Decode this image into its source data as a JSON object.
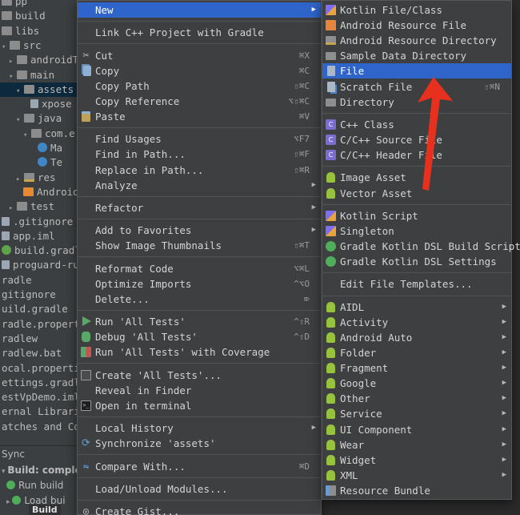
{
  "project_tree": {
    "rows": [
      {
        "label": "pp",
        "indent": 0,
        "arrow": "",
        "icon": "folder"
      },
      {
        "label": "build",
        "indent": 0,
        "arrow": "",
        "icon": "folder"
      },
      {
        "label": "libs",
        "indent": 0,
        "arrow": "",
        "icon": "folder"
      },
      {
        "label": "src",
        "indent": 0,
        "arrow": "▾",
        "icon": "folder"
      },
      {
        "label": "androidTes",
        "indent": 1,
        "arrow": "▸",
        "icon": "folder"
      },
      {
        "label": "main",
        "indent": 1,
        "arrow": "▾",
        "icon": "folder"
      },
      {
        "label": "assets",
        "indent": 2,
        "arrow": "▾",
        "icon": "folder",
        "selected": true
      },
      {
        "label": "xpose",
        "indent": 4,
        "arrow": "",
        "icon": "file"
      },
      {
        "label": "java",
        "indent": 2,
        "arrow": "▾",
        "icon": "folder"
      },
      {
        "label": "com.e",
        "indent": 3,
        "arrow": "▾",
        "icon": "folder"
      },
      {
        "label": "Ma",
        "indent": 5,
        "arrow": "",
        "icon": "cls"
      },
      {
        "label": "Te",
        "indent": 5,
        "arrow": "",
        "icon": "cls"
      },
      {
        "label": "res",
        "indent": 2,
        "arrow": "▸",
        "icon": "res"
      },
      {
        "label": "Android",
        "indent": 3,
        "arrow": "",
        "icon": "android"
      },
      {
        "label": "test",
        "indent": 1,
        "arrow": "▸",
        "icon": "folder"
      },
      {
        "label": ".gitignore",
        "indent": 0,
        "arrow": "",
        "icon": "file"
      },
      {
        "label": "app.iml",
        "indent": 0,
        "arrow": "",
        "icon": "file"
      },
      {
        "label": "build.gradle",
        "indent": 0,
        "arrow": "",
        "icon": "gradle"
      },
      {
        "label": "proguard-rule",
        "indent": 0,
        "arrow": "",
        "icon": "file"
      },
      {
        "label": "radle",
        "indent": 0,
        "arrow": "",
        "icon": ""
      },
      {
        "label": "gitignore",
        "indent": 0,
        "arrow": "",
        "icon": ""
      },
      {
        "label": "uild.gradle",
        "indent": 0,
        "arrow": "",
        "icon": ""
      },
      {
        "label": "radle.properti",
        "indent": 0,
        "arrow": "",
        "icon": ""
      },
      {
        "label": "radlew",
        "indent": 0,
        "arrow": "",
        "icon": ""
      },
      {
        "label": "radlew.bat",
        "indent": 0,
        "arrow": "",
        "icon": ""
      },
      {
        "label": "ocal.propertie",
        "indent": 0,
        "arrow": "",
        "icon": ""
      },
      {
        "label": "ettings.gradle",
        "indent": 0,
        "arrow": "",
        "icon": ""
      },
      {
        "label": "estVpDemo.iml",
        "indent": 0,
        "arrow": "",
        "icon": ""
      },
      {
        "label": "ernal Libraries",
        "indent": 0,
        "arrow": "",
        "icon": ""
      },
      {
        "label": "atches and Cons",
        "indent": 0,
        "arrow": "",
        "icon": ""
      }
    ]
  },
  "build_panel": {
    "sync_label": "Sync",
    "build_status": "Build: comple",
    "run_build": "Run build",
    "load_build": "Load bui",
    "build_tab": "Build"
  },
  "main_menu": {
    "items": [
      {
        "label": "New",
        "shortcut": "",
        "submenu": true,
        "icon": "",
        "active": true
      },
      {
        "sep": true
      },
      {
        "label": "Link C++ Project with Gradle",
        "shortcut": "",
        "submenu": false,
        "icon": ""
      },
      {
        "sep": true
      },
      {
        "label": "Cut",
        "shortcut": "⌘X",
        "submenu": false,
        "icon": "cut"
      },
      {
        "label": "Copy",
        "shortcut": "⌘C",
        "submenu": false,
        "icon": "copy"
      },
      {
        "label": "Copy Path",
        "shortcut": "⇧⌘C",
        "submenu": false,
        "icon": ""
      },
      {
        "label": "Copy Reference",
        "shortcut": "⌥⇧⌘C",
        "submenu": false,
        "icon": ""
      },
      {
        "label": "Paste",
        "shortcut": "⌘V",
        "submenu": false,
        "icon": "paste"
      },
      {
        "sep": true
      },
      {
        "label": "Find Usages",
        "shortcut": "⌥F7",
        "submenu": false,
        "icon": ""
      },
      {
        "label": "Find in Path...",
        "shortcut": "⇧⌘F",
        "submenu": false,
        "icon": ""
      },
      {
        "label": "Replace in Path...",
        "shortcut": "⇧⌘R",
        "submenu": false,
        "icon": ""
      },
      {
        "label": "Analyze",
        "shortcut": "",
        "submenu": true,
        "icon": ""
      },
      {
        "sep": true
      },
      {
        "label": "Refactor",
        "shortcut": "",
        "submenu": true,
        "icon": ""
      },
      {
        "sep": true
      },
      {
        "label": "Add to Favorites",
        "shortcut": "",
        "submenu": true,
        "icon": ""
      },
      {
        "label": "Show Image Thumbnails",
        "shortcut": "⇧⌘T",
        "submenu": false,
        "icon": ""
      },
      {
        "sep": true
      },
      {
        "label": "Reformat Code",
        "shortcut": "⌥⌘L",
        "submenu": false,
        "icon": ""
      },
      {
        "label": "Optimize Imports",
        "shortcut": "^⌥O",
        "submenu": false,
        "icon": ""
      },
      {
        "label": "Delete...",
        "shortcut": "⌦",
        "submenu": false,
        "icon": ""
      },
      {
        "sep": true
      },
      {
        "label": "Run 'All Tests'",
        "shortcut": "^⇧R",
        "submenu": false,
        "icon": "run"
      },
      {
        "label": "Debug 'All Tests'",
        "shortcut": "^⇧D",
        "submenu": false,
        "icon": "debug"
      },
      {
        "label": "Run 'All Tests' with Coverage",
        "shortcut": "",
        "submenu": false,
        "icon": "coverage"
      },
      {
        "sep": true
      },
      {
        "label": "Create 'All Tests'...",
        "shortcut": "",
        "submenu": false,
        "icon": "create"
      },
      {
        "label": "Reveal in Finder",
        "shortcut": "",
        "submenu": false,
        "icon": ""
      },
      {
        "label": "Open in terminal",
        "shortcut": "",
        "submenu": false,
        "icon": "terminal"
      },
      {
        "sep": true
      },
      {
        "label": "Local History",
        "shortcut": "",
        "submenu": true,
        "icon": ""
      },
      {
        "label": "Synchronize 'assets'",
        "shortcut": "",
        "submenu": false,
        "icon": "sync"
      },
      {
        "sep": true
      },
      {
        "label": "Compare With...",
        "shortcut": "⌘D",
        "submenu": false,
        "icon": "compare"
      },
      {
        "sep": true
      },
      {
        "label": "Load/Unload Modules...",
        "shortcut": "",
        "submenu": false,
        "icon": ""
      },
      {
        "sep": true
      },
      {
        "label": "Create Gist...",
        "shortcut": "",
        "submenu": false,
        "icon": "gist"
      }
    ]
  },
  "new_submenu": {
    "items": [
      {
        "label": "Kotlin File/Class",
        "shortcut": "",
        "submenu": false,
        "icon": "kotlin"
      },
      {
        "label": "Android Resource File",
        "shortcut": "",
        "submenu": false,
        "icon": "resfile"
      },
      {
        "label": "Android Resource Directory",
        "shortcut": "",
        "submenu": false,
        "icon": "resfolder"
      },
      {
        "label": "Sample Data Directory",
        "shortcut": "",
        "submenu": false,
        "icon": "folder"
      },
      {
        "label": "File",
        "shortcut": "",
        "submenu": false,
        "icon": "file",
        "active": true
      },
      {
        "label": "Scratch File",
        "shortcut": "⇧⌘N",
        "submenu": false,
        "icon": "scratch"
      },
      {
        "label": "Directory",
        "shortcut": "",
        "submenu": false,
        "icon": "folder"
      },
      {
        "sep": true
      },
      {
        "label": "C++ Class",
        "shortcut": "",
        "submenu": false,
        "icon": "cpp"
      },
      {
        "label": "C/C++ Source File",
        "shortcut": "",
        "submenu": false,
        "icon": "cpp"
      },
      {
        "label": "C/C++ Header File",
        "shortcut": "",
        "submenu": false,
        "icon": "cpp"
      },
      {
        "sep": true
      },
      {
        "label": "Image Asset",
        "shortcut": "",
        "submenu": false,
        "icon": "android"
      },
      {
        "label": "Vector Asset",
        "shortcut": "",
        "submenu": false,
        "icon": "android"
      },
      {
        "sep": true
      },
      {
        "label": "Kotlin Script",
        "shortcut": "",
        "submenu": false,
        "icon": "kotlin"
      },
      {
        "label": "Singleton",
        "shortcut": "",
        "submenu": false,
        "icon": "kotlin"
      },
      {
        "label": "Gradle Kotlin DSL Build Script",
        "shortcut": "",
        "submenu": false,
        "icon": "gradle"
      },
      {
        "label": "Gradle Kotlin DSL Settings",
        "shortcut": "",
        "submenu": false,
        "icon": "gradle"
      },
      {
        "sep": true
      },
      {
        "label": "Edit File Templates...",
        "shortcut": "",
        "submenu": false,
        "icon": ""
      },
      {
        "sep": true
      },
      {
        "label": "AIDL",
        "shortcut": "",
        "submenu": true,
        "icon": "android"
      },
      {
        "label": "Activity",
        "shortcut": "",
        "submenu": true,
        "icon": "android"
      },
      {
        "label": "Android Auto",
        "shortcut": "",
        "submenu": true,
        "icon": "android"
      },
      {
        "label": "Folder",
        "shortcut": "",
        "submenu": true,
        "icon": "android"
      },
      {
        "label": "Fragment",
        "shortcut": "",
        "submenu": true,
        "icon": "android"
      },
      {
        "label": "Google",
        "shortcut": "",
        "submenu": true,
        "icon": "android"
      },
      {
        "label": "Other",
        "shortcut": "",
        "submenu": true,
        "icon": "android"
      },
      {
        "label": "Service",
        "shortcut": "",
        "submenu": true,
        "icon": "android"
      },
      {
        "label": "UI Component",
        "shortcut": "",
        "submenu": true,
        "icon": "android"
      },
      {
        "label": "Wear",
        "shortcut": "",
        "submenu": true,
        "icon": "android"
      },
      {
        "label": "Widget",
        "shortcut": "",
        "submenu": true,
        "icon": "android"
      },
      {
        "label": "XML",
        "shortcut": "",
        "submenu": true,
        "icon": "android"
      },
      {
        "label": "Resource Bundle",
        "shortcut": "",
        "submenu": false,
        "icon": "bundle"
      }
    ]
  },
  "colors": {
    "menu_bg": "#3d3f41",
    "highlight": "#2f65ca",
    "annotation_arrow": "#e8301f"
  }
}
